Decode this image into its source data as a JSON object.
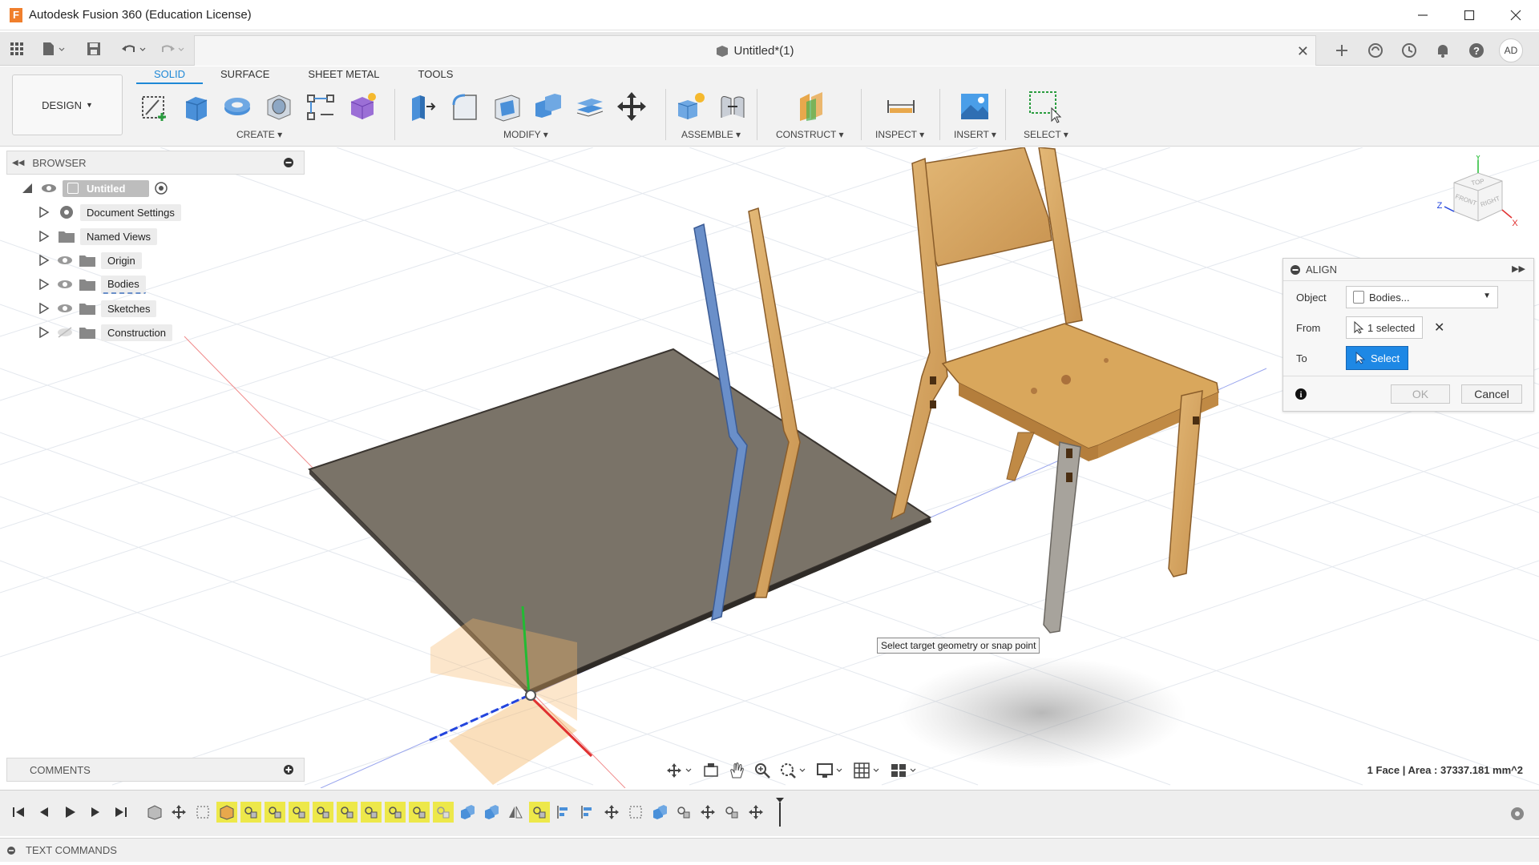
{
  "window": {
    "title": "Autodesk Fusion 360 (Education License)",
    "app_icon_letter": "F"
  },
  "document": {
    "tab_title": "Untitled*(1)",
    "user_initials": "AD"
  },
  "ribbon": {
    "workspace": "DESIGN",
    "tabs": [
      "SOLID",
      "SURFACE",
      "SHEET METAL",
      "TOOLS"
    ],
    "active_tab": "SOLID",
    "groups": {
      "create": "CREATE",
      "modify": "MODIFY",
      "assemble": "ASSEMBLE",
      "construct": "CONSTRUCT",
      "inspect": "INSPECT",
      "insert": "INSERT",
      "select": "SELECT"
    }
  },
  "browser": {
    "title": "BROWSER",
    "root": "Untitled",
    "items": [
      {
        "label": "Document Settings",
        "icon": "gear-icon"
      },
      {
        "label": "Named Views",
        "icon": "folder-icon"
      },
      {
        "label": "Origin",
        "icon": "folder-icon"
      },
      {
        "label": "Bodies",
        "icon": "folder-icon"
      },
      {
        "label": "Sketches",
        "icon": "folder-icon"
      },
      {
        "label": "Construction",
        "icon": "folder-icon"
      }
    ]
  },
  "align_dialog": {
    "title": "ALIGN",
    "object_label": "Object",
    "object_value": "Bodies...",
    "from_label": "From",
    "from_value": "1 selected",
    "to_label": "To",
    "to_value": "Select",
    "ok": "OK",
    "cancel": "Cancel"
  },
  "viewport": {
    "tooltip": "Select target geometry or snap point",
    "viewcube": {
      "front": "FRONT",
      "right": "RIGHT",
      "top": "TOP",
      "axis_x": "X",
      "axis_y": "Y",
      "axis_z": "Z"
    }
  },
  "comments": {
    "title": "COMMENTS"
  },
  "status": {
    "text": "1 Face | Area : 37337.181 mm^2"
  },
  "text_commands": {
    "title": "TEXT COMMANDS"
  },
  "colors": {
    "accent": "#1e88e5",
    "timeline_highlight": "#ede84a",
    "wood": "#d9a95f",
    "selected_body": "#6a8fc9",
    "ground_plate": "#7a7368"
  }
}
